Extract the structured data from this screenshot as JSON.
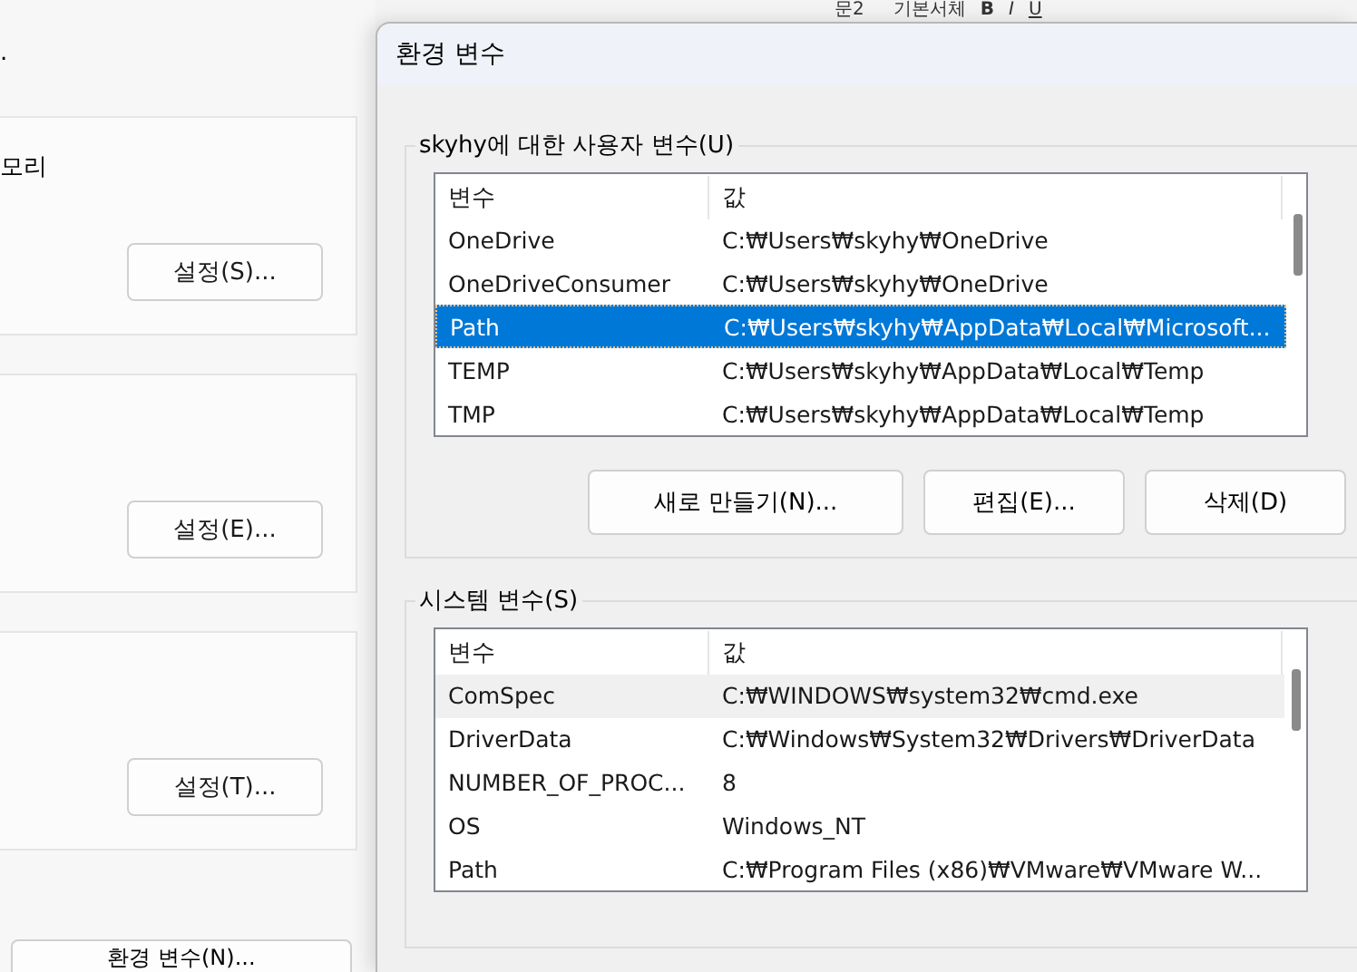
{
  "background_toolbar": {
    "style_name": "문2",
    "font_name": "기본서체",
    "format_buttons": [
      "B",
      "I",
      "U"
    ]
  },
  "settings_panel": {
    "heading_fragment": ".",
    "cards": [
      {
        "label": "모리",
        "button": "설정(S)..."
      },
      {
        "button": "설정(E)..."
      },
      {
        "button": "설정(T)..."
      }
    ],
    "env_button": "환경 변수(N)..."
  },
  "window": {
    "title": "환경 변수"
  },
  "user_variables": {
    "title": "skyhy에 대한 사용자 변수(U)",
    "columns": [
      "변수",
      "값"
    ],
    "rows": [
      {
        "name": "OneDrive",
        "value": "C:₩Users₩skyhy₩OneDrive",
        "selected": false
      },
      {
        "name": "OneDriveConsumer",
        "value": "C:₩Users₩skyhy₩OneDrive",
        "selected": false
      },
      {
        "name": "Path",
        "value": "C:₩Users₩skyhy₩AppData₩Local₩Microsoft...",
        "selected": true
      },
      {
        "name": "TEMP",
        "value": "C:₩Users₩skyhy₩AppData₩Local₩Temp",
        "selected": false
      },
      {
        "name": "TMP",
        "value": "C:₩Users₩skyhy₩AppData₩Local₩Temp",
        "selected": false
      }
    ],
    "buttons": [
      "새로 만들기(N)...",
      "편집(E)...",
      "삭제(D)"
    ]
  },
  "system_variables": {
    "title": "시스템 변수(S)",
    "columns": [
      "변수",
      "값"
    ],
    "rows": [
      {
        "name": "ComSpec",
        "value": "C:₩WINDOWS₩system32₩cmd.exe",
        "selected": false,
        "hovered": true
      },
      {
        "name": "DriverData",
        "value": "C:₩Windows₩System32₩Drivers₩DriverData",
        "selected": false,
        "hovered": false
      },
      {
        "name": "NUMBER_OF_PROC...",
        "value": "8",
        "selected": false,
        "hovered": false
      },
      {
        "name": "OS",
        "value": "Windows_NT",
        "selected": false,
        "hovered": false
      },
      {
        "name": "Path",
        "value": "C:₩Program Files (x86)₩VMware₩VMware W...",
        "selected": false,
        "hovered": false
      }
    ]
  }
}
